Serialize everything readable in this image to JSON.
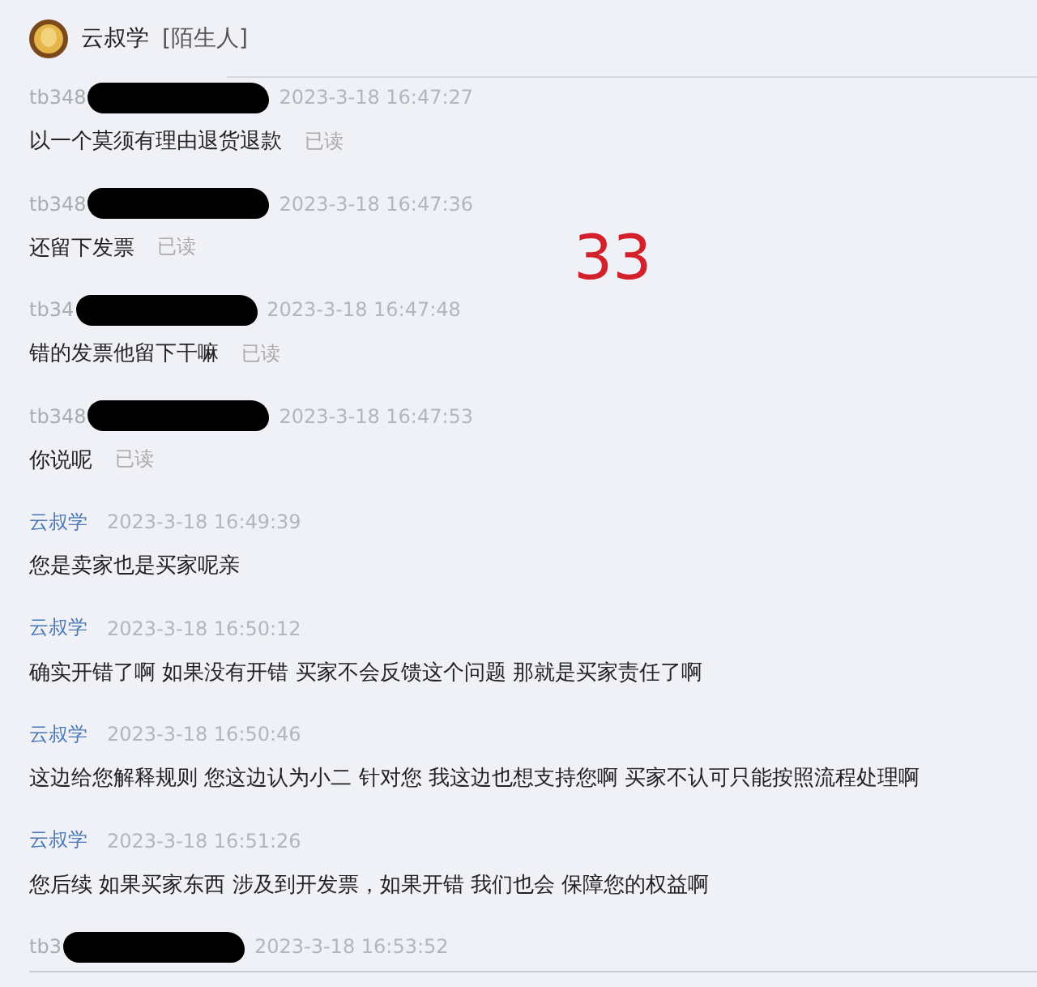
{
  "header": {
    "contact_name": "云叔学",
    "contact_tag": "[陌生人]"
  },
  "annotation": {
    "text": "33"
  },
  "messages": [
    {
      "kind": "buyer",
      "sender": "tb348",
      "redacted": true,
      "time": "2023-3-18 16:47:27",
      "text": "以一个莫须有理由退货退款",
      "read_status": "已读"
    },
    {
      "kind": "buyer",
      "sender": "tb348",
      "redacted": true,
      "time": "2023-3-18 16:47:36",
      "text": "还留下发票",
      "read_status": "已读"
    },
    {
      "kind": "buyer",
      "sender": "tb34",
      "redacted": true,
      "time": "2023-3-18 16:47:48",
      "text": "错的发票他留下干嘛",
      "read_status": "已读"
    },
    {
      "kind": "buyer",
      "sender": "tb348",
      "redacted": true,
      "time": "2023-3-18 16:47:53",
      "text": "你说呢",
      "read_status": "已读"
    },
    {
      "kind": "agent",
      "sender": "云叔学",
      "redacted": false,
      "time": "2023-3-18 16:49:39",
      "text": "您是卖家也是买家呢亲"
    },
    {
      "kind": "agent",
      "sender": "云叔学",
      "redacted": false,
      "time": "2023-3-18 16:50:12",
      "text": "确实开错了啊 如果没有开错 买家不会反馈这个问题  那就是买家责任了啊"
    },
    {
      "kind": "agent",
      "sender": "云叔学",
      "redacted": false,
      "time": "2023-3-18 16:50:46",
      "text": "这边给您解释规则 您这边认为小二 针对您  我这边也想支持您啊 买家不认可只能按照流程处理啊"
    },
    {
      "kind": "agent",
      "sender": "云叔学",
      "redacted": false,
      "time": "2023-3-18 16:51:26",
      "text": "您后续 如果买家东西 涉及到开发票，如果开错 我们也会 保障您的权益啊"
    },
    {
      "kind": "buyer",
      "sender": "tb3",
      "redacted": true,
      "time": "2023-3-18 16:53:52"
    }
  ]
}
